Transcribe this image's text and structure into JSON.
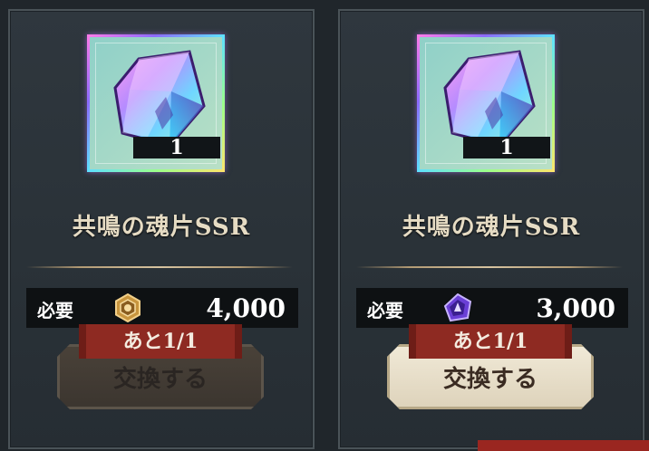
{
  "cards": [
    {
      "item_name": "共鳴の魂片SSR",
      "quantity": "1",
      "cost_label": "必要",
      "currency_icon": "gold-hexagon-medal-icon",
      "cost_value": "4,000",
      "remaining": "あと1/1",
      "button_label": "交換する",
      "button_state": "disabled"
    },
    {
      "item_name": "共鳴の魂片SSR",
      "quantity": "1",
      "cost_label": "必要",
      "currency_icon": "purple-crystal-token-icon",
      "cost_value": "3,000",
      "remaining": "あと1/1",
      "button_label": "交換する",
      "button_state": "active"
    }
  ],
  "colors": {
    "card_bg": "#2f373e",
    "name_text": "#e6dcc4",
    "tag_red": "#8e2a22",
    "button_active": "#f1ead8",
    "button_disabled": "#4a4239"
  }
}
